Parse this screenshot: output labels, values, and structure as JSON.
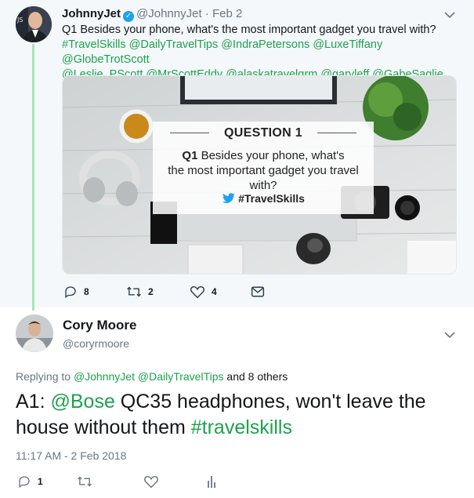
{
  "tweet1": {
    "author_name": "JohnnyJet",
    "author_handle": "@JohnnyJet",
    "date": "Feb 2",
    "text": "Q1 Besides your phone, what's the most important gadget you travel with?",
    "tags_line1": "#TravelSkills @DailyTravelTips @IndraPetersons @LuxeTiffany @GlobeTrotScott",
    "tags_line2": "@Leslie_PScott @MrScottEddy @alaskatravelgrm @garyleff @GabeSaglie",
    "image": {
      "title": "QUESTION 1",
      "question_prefix": "Q1",
      "question_line1": " Besides your phone, what's",
      "question_line2": "the most important gadget you travel with?",
      "hashtag": "#TravelSkills"
    },
    "actions": {
      "replies": "8",
      "retweets": "2",
      "likes": "4"
    }
  },
  "tweet2": {
    "author_name": "Cory Moore",
    "author_handle": "@coryrmoore",
    "replying_prefix": "Replying to ",
    "replying_user1": "@JohnnyJet",
    "replying_user2": "@DailyTravelTips",
    "replying_suffix": " and 8 others",
    "text_prefix": "A1: ",
    "mention": "@Bose",
    "text_middle": " QC35 headphones, won't leave the house without them ",
    "hashtag": "#travelskills",
    "timestamp": "11:17 AM - 2 Feb 2018",
    "actions": {
      "replies": "1"
    }
  },
  "colors": {
    "link_green": "#1da14f",
    "thread_line": "#a8e6b0",
    "verified_blue": "#1da1f2",
    "muted_gray": "#657786"
  },
  "icons": [
    "verified-icon",
    "chevron-down-icon",
    "reply-icon",
    "retweet-icon",
    "like-icon",
    "dm-icon",
    "analytics-icon"
  ]
}
